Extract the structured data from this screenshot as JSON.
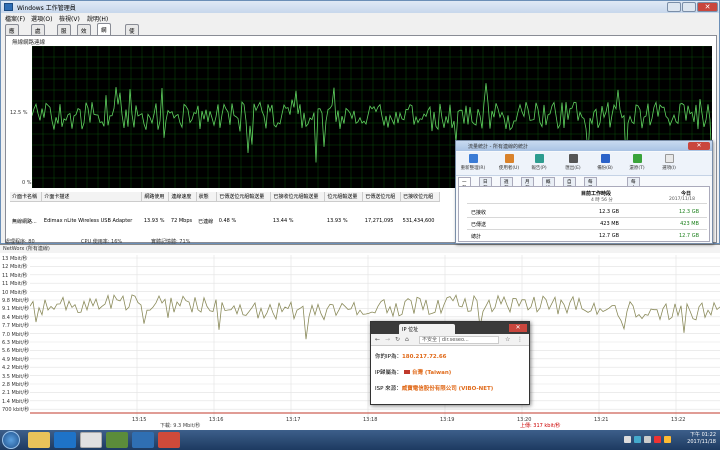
{
  "taskmgr": {
    "title": "Windows 工作管理員",
    "menu": [
      "檔案(F)",
      "選項(O)",
      "檢視(V)",
      "說明(H)"
    ],
    "tabs": [
      "應用程式",
      "處理程序",
      "服務",
      "效能",
      "網路功能",
      "使用者"
    ],
    "active_tab": 4,
    "graph_title": "無線網路連線",
    "axis": {
      "top": "",
      "mid": "12.5 %",
      "bottom": "0 %"
    },
    "table_headers": [
      "介面卡名稱",
      "介面卡描述",
      "網路使用",
      "連線速度",
      "狀態",
      "已傳送位元組輸送量",
      "已接收位元組輸送量",
      "位元組輸送量",
      "已傳送位元組",
      "已接收位元組"
    ],
    "table_row": [
      "無線網路...",
      "Edimax nLite Wireless USB Adapter",
      "13.93 %",
      "72 Mbps",
      "已連線",
      "0.48 %",
      "13.44 %",
      "13.93 %",
      "17,271,095",
      "531,434,600"
    ],
    "status": [
      "處理程序: 80",
      "CPU 使用率: 16%",
      "實體記憶體: 71%"
    ]
  },
  "networx": {
    "title": "NetWorx (所有連線)",
    "y_labels": [
      "13 Mbit/秒",
      "12 Mbit/秒",
      "11 Mbit/秒",
      "11 Mbit/秒",
      "10 Mbit/秒",
      "9.8 Mbit/秒",
      "9.1 Mbit/秒",
      "8.4 Mbit/秒",
      "7.7 Mbit/秒",
      "7.0 Mbit/秒",
      "6.3 Mbit/秒",
      "5.6 Mbit/秒",
      "4.9 Mbit/秒",
      "4.2 Mbit/秒",
      "3.5 Mbit/秒",
      "2.8 Mbit/秒",
      "2.1 Mbit/秒",
      "1.4 Mbit/秒",
      "700 kbit/秒"
    ],
    "x_labels": [
      "13:15",
      "13:16",
      "13:17",
      "13:18",
      "13:19",
      "13:20",
      "13:21",
      "13:22"
    ],
    "down_label": "下載: 9.3 Mbit/秒",
    "up_label": "上傳: 317 kbit/秒",
    "colors": {
      "download": "#8a8a5a",
      "upload": "#c0392b"
    }
  },
  "resmon": {
    "title": "流量統計 - 所有連線的統計",
    "toolbar": [
      "重新整理(R)",
      "使用者(U)",
      "報告(P)",
      "匯出(E)",
      "備份(B)",
      "還原(T)",
      "選項(I)"
    ],
    "tabs": [
      "一般",
      "日報",
      "週報",
      "月報",
      "概述",
      "自訂",
      "每日工作時段",
      "每小時分析"
    ],
    "col1_header": "目前工作時段",
    "col1_sub": "4 時 56 分",
    "col2_header": "今日",
    "col2_sub": "2017/11/18",
    "rows": [
      {
        "label": "已接收",
        "v1": "12.3 GB",
        "v2": "12.3 GB"
      },
      {
        "label": "已傳送",
        "v1": "423 MB",
        "v2": "423 MB"
      },
      {
        "label": "總計",
        "v1": "12.7 GB",
        "v2": "12.7 GB"
      }
    ]
  },
  "browser": {
    "tab_label": "IP 位址",
    "url_prefix": "不安全",
    "url": "dir.seseo...",
    "line1_label": "你的IP為：",
    "line1_value": "180.217.72.66",
    "line2_label": "IP歸屬為：",
    "line2_value": "台灣 (Taiwan)",
    "line3_label": "ISP 來源：",
    "line3_value": "威寶電信股份有限公司 (VIBO-NET)"
  },
  "taskbar": {
    "clock_time": "下午 01:22",
    "clock_date": "2017/11/18"
  }
}
